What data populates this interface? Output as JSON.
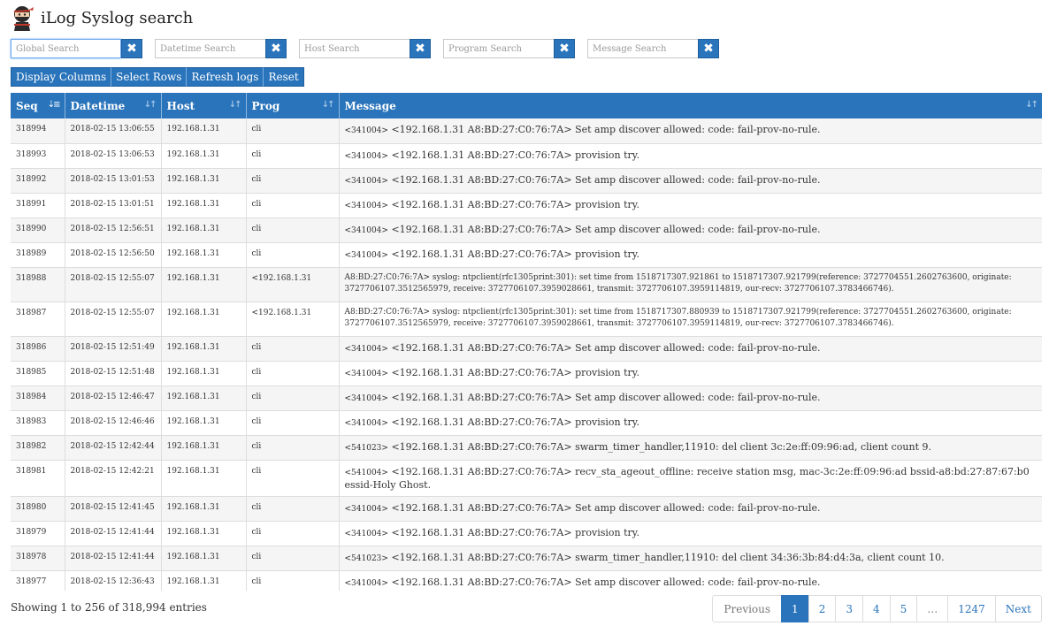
{
  "app": {
    "title": "iLog Syslog search"
  },
  "search": [
    {
      "name": "global",
      "placeholder": "Global Search",
      "value": ""
    },
    {
      "name": "datetime",
      "placeholder": "Datetime Search",
      "value": ""
    },
    {
      "name": "host",
      "placeholder": "Host Search",
      "value": ""
    },
    {
      "name": "program",
      "placeholder": "Program Search",
      "value": ""
    },
    {
      "name": "message",
      "placeholder": "Message Search",
      "value": ""
    }
  ],
  "clear_symbol": "✖",
  "toolbar": {
    "display_columns": "Display Columns",
    "select_rows": "Select Rows",
    "refresh_logs": "Refresh logs",
    "reset": "Reset"
  },
  "table": {
    "columns": [
      "Seq",
      "Datetime",
      "Host",
      "Prog",
      "Message"
    ],
    "rows": [
      {
        "seq": "318994",
        "datetime": "2018-02-15 13:06:55",
        "host": "192.168.1.31",
        "prog": "cli",
        "code": "<341004>",
        "message": "<192.168.1.31 A8:BD:27:C0:76:7A> Set amp discover allowed: code: fail-prov-no-rule."
      },
      {
        "seq": "318993",
        "datetime": "2018-02-15 13:06:53",
        "host": "192.168.1.31",
        "prog": "cli",
        "code": "<341004>",
        "message": "<192.168.1.31 A8:BD:27:C0:76:7A> provision try."
      },
      {
        "seq": "318992",
        "datetime": "2018-02-15 13:01:53",
        "host": "192.168.1.31",
        "prog": "cli",
        "code": "<341004>",
        "message": "<192.168.1.31 A8:BD:27:C0:76:7A> Set amp discover allowed: code: fail-prov-no-rule."
      },
      {
        "seq": "318991",
        "datetime": "2018-02-15 13:01:51",
        "host": "192.168.1.31",
        "prog": "cli",
        "code": "<341004>",
        "message": "<192.168.1.31 A8:BD:27:C0:76:7A> provision try."
      },
      {
        "seq": "318990",
        "datetime": "2018-02-15 12:56:51",
        "host": "192.168.1.31",
        "prog": "cli",
        "code": "<341004>",
        "message": "<192.168.1.31 A8:BD:27:C0:76:7A> Set amp discover allowed: code: fail-prov-no-rule."
      },
      {
        "seq": "318989",
        "datetime": "2018-02-15 12:56:50",
        "host": "192.168.1.31",
        "prog": "cli",
        "code": "<341004>",
        "message": "<192.168.1.31 A8:BD:27:C0:76:7A> provision try."
      },
      {
        "seq": "318988",
        "datetime": "2018-02-15 12:55:07",
        "host": "192.168.1.31",
        "prog": "<192.168.1.31",
        "code": "",
        "message": "A8:BD:27:C0:76:7A> syslog: ntpclient(rfc1305print:301): set time from 1518717307.921861 to 1518717307.921799(reference: 3727704551.2602763600, originate: 3727706107.3512565979, receive: 3727706107.3959028661, transmit: 3727706107.3959114819, our-recv: 3727706107.3783466746)."
      },
      {
        "seq": "318987",
        "datetime": "2018-02-15 12:55:07",
        "host": "192.168.1.31",
        "prog": "<192.168.1.31",
        "code": "",
        "message": "A8:BD:27:C0:76:7A> syslog: ntpclient(rfc1305print:301): set time from 1518717307.880939 to 1518717307.921799(reference: 3727704551.2602763600, originate: 3727706107.3512565979, receive: 3727706107.3959028661, transmit: 3727706107.3959114819, our-recv: 3727706107.3783466746)."
      },
      {
        "seq": "318986",
        "datetime": "2018-02-15 12:51:49",
        "host": "192.168.1.31",
        "prog": "cli",
        "code": "<341004>",
        "message": "<192.168.1.31 A8:BD:27:C0:76:7A> Set amp discover allowed: code: fail-prov-no-rule."
      },
      {
        "seq": "318985",
        "datetime": "2018-02-15 12:51:48",
        "host": "192.168.1.31",
        "prog": "cli",
        "code": "<341004>",
        "message": "<192.168.1.31 A8:BD:27:C0:76:7A> provision try."
      },
      {
        "seq": "318984",
        "datetime": "2018-02-15 12:46:47",
        "host": "192.168.1.31",
        "prog": "cli",
        "code": "<341004>",
        "message": "<192.168.1.31 A8:BD:27:C0:76:7A> Set amp discover allowed: code: fail-prov-no-rule."
      },
      {
        "seq": "318983",
        "datetime": "2018-02-15 12:46:46",
        "host": "192.168.1.31",
        "prog": "cli",
        "code": "<341004>",
        "message": "<192.168.1.31 A8:BD:27:C0:76:7A> provision try."
      },
      {
        "seq": "318982",
        "datetime": "2018-02-15 12:42:44",
        "host": "192.168.1.31",
        "prog": "cli",
        "code": "<541023>",
        "message": "<192.168.1.31 A8:BD:27:C0:76:7A> swarm_timer_handler,11910: del client 3c:2e:ff:09:96:ad, client count 9."
      },
      {
        "seq": "318981",
        "datetime": "2018-02-15 12:42:21",
        "host": "192.168.1.31",
        "prog": "cli",
        "code": "<541004>",
        "message": "<192.168.1.31 A8:BD:27:C0:76:7A> recv_sta_ageout_offline: receive station msg, mac-3c:2e:ff:09:96:ad bssid-a8:bd:27:87:67:b0 essid-Holy Ghost."
      },
      {
        "seq": "318980",
        "datetime": "2018-02-15 12:41:45",
        "host": "192.168.1.31",
        "prog": "cli",
        "code": "<341004>",
        "message": "<192.168.1.31 A8:BD:27:C0:76:7A> Set amp discover allowed: code: fail-prov-no-rule."
      },
      {
        "seq": "318979",
        "datetime": "2018-02-15 12:41:44",
        "host": "192.168.1.31",
        "prog": "cli",
        "code": "<341004>",
        "message": "<192.168.1.31 A8:BD:27:C0:76:7A> provision try."
      },
      {
        "seq": "318978",
        "datetime": "2018-02-15 12:41:44",
        "host": "192.168.1.31",
        "prog": "cli",
        "code": "<541023>",
        "message": "<192.168.1.31 A8:BD:27:C0:76:7A> swarm_timer_handler,11910: del client 34:36:3b:84:d4:3a, client count 10."
      },
      {
        "seq": "318977",
        "datetime": "2018-02-15 12:36:43",
        "host": "192.168.1.31",
        "prog": "cli",
        "code": "<341004>",
        "message": "<192.168.1.31 A8:BD:27:C0:76:7A> Set amp discover allowed: code: fail-prov-no-rule."
      }
    ]
  },
  "footer": {
    "info": "Showing 1 to 256 of 318,994 entries"
  },
  "pagination": {
    "previous": "Previous",
    "pages": [
      "1",
      "2",
      "3",
      "4",
      "5",
      "…",
      "1247"
    ],
    "active": "1",
    "next": "Next"
  },
  "colors": {
    "accent": "#2a74bb",
    "row_stripe": "#f5f5f5"
  }
}
